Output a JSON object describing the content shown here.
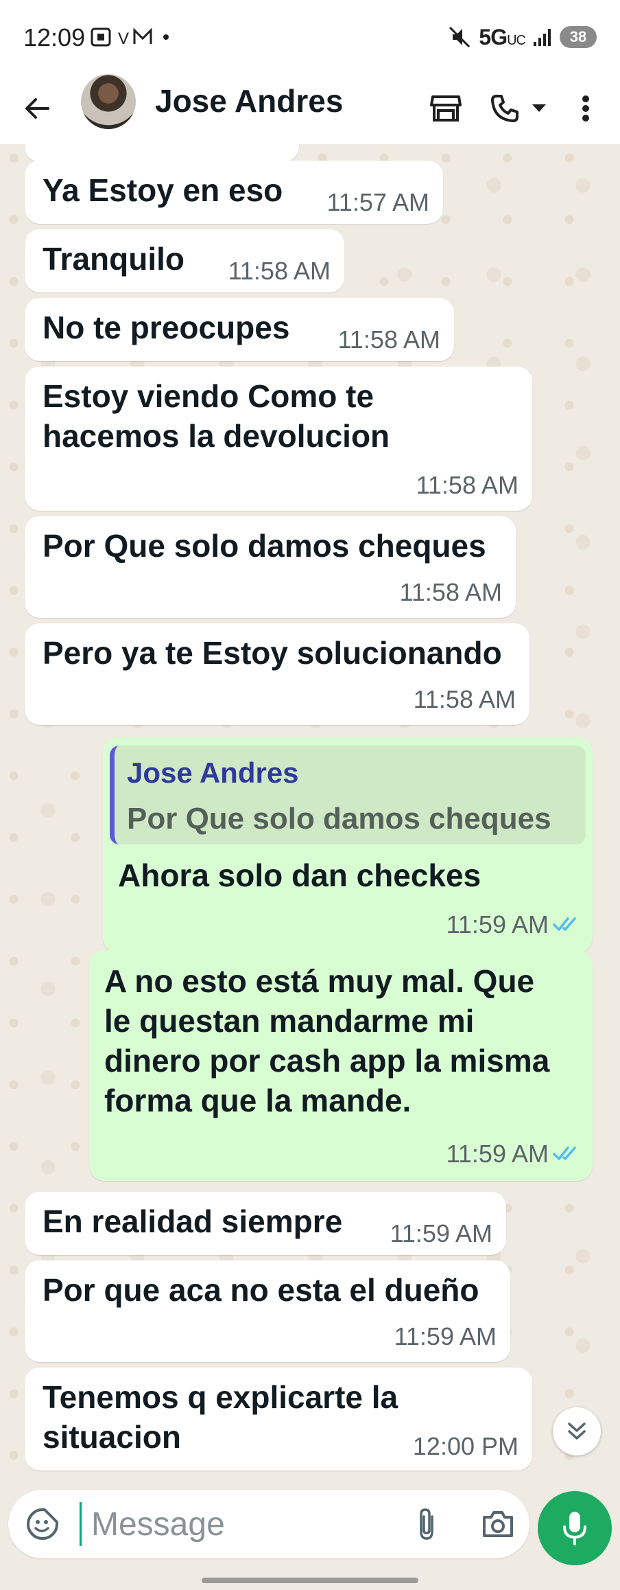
{
  "status_bar": {
    "time": "12:09",
    "network": "5G",
    "network_sub": "UC",
    "battery": "38"
  },
  "header": {
    "contact_name": "Jose Andres"
  },
  "messages": [
    {
      "direction": "in",
      "text": [
        "Ya Estoy en eso"
      ],
      "time": "11:57 AM"
    },
    {
      "direction": "in",
      "text": [
        "Tranquilo"
      ],
      "time": "11:58 AM"
    },
    {
      "direction": "in",
      "text": [
        "No te preocupes"
      ],
      "time": "11:58 AM"
    },
    {
      "direction": "in",
      "text": [
        "Estoy viendo Como te",
        "hacemos la devolucion"
      ],
      "time": "11:58 AM"
    },
    {
      "direction": "in",
      "text": [
        "Por Que solo damos cheques"
      ],
      "time": "11:58 AM"
    },
    {
      "direction": "in",
      "text": [
        "Pero ya te Estoy solucionando"
      ],
      "time": "11:58 AM"
    },
    {
      "direction": "out",
      "quote": {
        "name": "Jose Andres",
        "text": "Por Que solo damos cheques"
      },
      "text": [
        "Ahora solo dan checkes"
      ],
      "time": "11:59 AM",
      "status": "read"
    },
    {
      "direction": "out",
      "text": [
        "A no esto está muy mal. Que",
        "le questan mandarme mi",
        "dinero por cash app la misma",
        "forma que la mande."
      ],
      "time": "11:59 AM",
      "status": "read"
    },
    {
      "direction": "in",
      "text": [
        "En realidad siempre"
      ],
      "time": "11:59 AM"
    },
    {
      "direction": "in",
      "text": [
        "Por que aca no esta el dueño"
      ],
      "time": "11:59 AM"
    },
    {
      "direction": "in",
      "text": [
        "Tenemos q explicarte la",
        "situacion"
      ],
      "time": "12:00 PM"
    }
  ],
  "composer": {
    "placeholder": "Message"
  },
  "colors": {
    "accent_green": "#1daa61",
    "outgoing_bubble": "#d9fdd3",
    "incoming_bubble": "#ffffff",
    "read_ticks": "#53bdeb",
    "chat_background": "#efeae2"
  },
  "icons": [
    "back-arrow-icon",
    "storefront-icon",
    "phone-icon",
    "chevron-down-icon",
    "more-vertical-icon",
    "sticker-icon",
    "attach-icon",
    "camera-icon",
    "mic-icon",
    "double-chevron-down-icon"
  ]
}
